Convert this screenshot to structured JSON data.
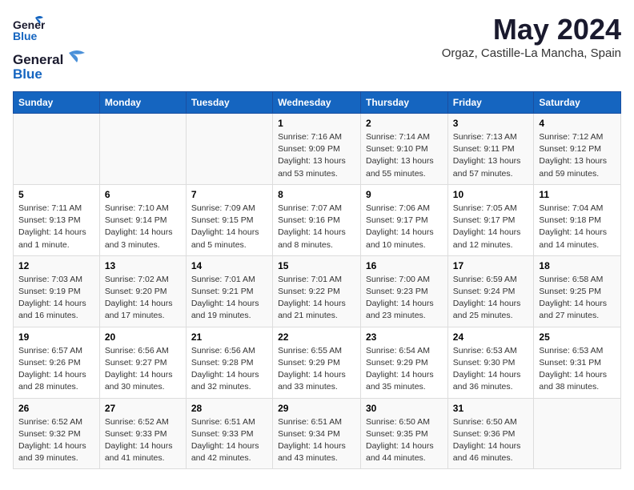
{
  "logo": {
    "line1": "General",
    "line2": "Blue"
  },
  "title": "May 2024",
  "subtitle": "Orgaz, Castille-La Mancha, Spain",
  "weekdays": [
    "Sunday",
    "Monday",
    "Tuesday",
    "Wednesday",
    "Thursday",
    "Friday",
    "Saturday"
  ],
  "weeks": [
    [
      {
        "day": "",
        "info": ""
      },
      {
        "day": "",
        "info": ""
      },
      {
        "day": "",
        "info": ""
      },
      {
        "day": "1",
        "info": "Sunrise: 7:16 AM\nSunset: 9:09 PM\nDaylight: 13 hours and 53 minutes."
      },
      {
        "day": "2",
        "info": "Sunrise: 7:14 AM\nSunset: 9:10 PM\nDaylight: 13 hours and 55 minutes."
      },
      {
        "day": "3",
        "info": "Sunrise: 7:13 AM\nSunset: 9:11 PM\nDaylight: 13 hours and 57 minutes."
      },
      {
        "day": "4",
        "info": "Sunrise: 7:12 AM\nSunset: 9:12 PM\nDaylight: 13 hours and 59 minutes."
      }
    ],
    [
      {
        "day": "5",
        "info": "Sunrise: 7:11 AM\nSunset: 9:13 PM\nDaylight: 14 hours and 1 minute."
      },
      {
        "day": "6",
        "info": "Sunrise: 7:10 AM\nSunset: 9:14 PM\nDaylight: 14 hours and 3 minutes."
      },
      {
        "day": "7",
        "info": "Sunrise: 7:09 AM\nSunset: 9:15 PM\nDaylight: 14 hours and 5 minutes."
      },
      {
        "day": "8",
        "info": "Sunrise: 7:07 AM\nSunset: 9:16 PM\nDaylight: 14 hours and 8 minutes."
      },
      {
        "day": "9",
        "info": "Sunrise: 7:06 AM\nSunset: 9:17 PM\nDaylight: 14 hours and 10 minutes."
      },
      {
        "day": "10",
        "info": "Sunrise: 7:05 AM\nSunset: 9:17 PM\nDaylight: 14 hours and 12 minutes."
      },
      {
        "day": "11",
        "info": "Sunrise: 7:04 AM\nSunset: 9:18 PM\nDaylight: 14 hours and 14 minutes."
      }
    ],
    [
      {
        "day": "12",
        "info": "Sunrise: 7:03 AM\nSunset: 9:19 PM\nDaylight: 14 hours and 16 minutes."
      },
      {
        "day": "13",
        "info": "Sunrise: 7:02 AM\nSunset: 9:20 PM\nDaylight: 14 hours and 17 minutes."
      },
      {
        "day": "14",
        "info": "Sunrise: 7:01 AM\nSunset: 9:21 PM\nDaylight: 14 hours and 19 minutes."
      },
      {
        "day": "15",
        "info": "Sunrise: 7:01 AM\nSunset: 9:22 PM\nDaylight: 14 hours and 21 minutes."
      },
      {
        "day": "16",
        "info": "Sunrise: 7:00 AM\nSunset: 9:23 PM\nDaylight: 14 hours and 23 minutes."
      },
      {
        "day": "17",
        "info": "Sunrise: 6:59 AM\nSunset: 9:24 PM\nDaylight: 14 hours and 25 minutes."
      },
      {
        "day": "18",
        "info": "Sunrise: 6:58 AM\nSunset: 9:25 PM\nDaylight: 14 hours and 27 minutes."
      }
    ],
    [
      {
        "day": "19",
        "info": "Sunrise: 6:57 AM\nSunset: 9:26 PM\nDaylight: 14 hours and 28 minutes."
      },
      {
        "day": "20",
        "info": "Sunrise: 6:56 AM\nSunset: 9:27 PM\nDaylight: 14 hours and 30 minutes."
      },
      {
        "day": "21",
        "info": "Sunrise: 6:56 AM\nSunset: 9:28 PM\nDaylight: 14 hours and 32 minutes."
      },
      {
        "day": "22",
        "info": "Sunrise: 6:55 AM\nSunset: 9:29 PM\nDaylight: 14 hours and 33 minutes."
      },
      {
        "day": "23",
        "info": "Sunrise: 6:54 AM\nSunset: 9:29 PM\nDaylight: 14 hours and 35 minutes."
      },
      {
        "day": "24",
        "info": "Sunrise: 6:53 AM\nSunset: 9:30 PM\nDaylight: 14 hours and 36 minutes."
      },
      {
        "day": "25",
        "info": "Sunrise: 6:53 AM\nSunset: 9:31 PM\nDaylight: 14 hours and 38 minutes."
      }
    ],
    [
      {
        "day": "26",
        "info": "Sunrise: 6:52 AM\nSunset: 9:32 PM\nDaylight: 14 hours and 39 minutes."
      },
      {
        "day": "27",
        "info": "Sunrise: 6:52 AM\nSunset: 9:33 PM\nDaylight: 14 hours and 41 minutes."
      },
      {
        "day": "28",
        "info": "Sunrise: 6:51 AM\nSunset: 9:33 PM\nDaylight: 14 hours and 42 minutes."
      },
      {
        "day": "29",
        "info": "Sunrise: 6:51 AM\nSunset: 9:34 PM\nDaylight: 14 hours and 43 minutes."
      },
      {
        "day": "30",
        "info": "Sunrise: 6:50 AM\nSunset: 9:35 PM\nDaylight: 14 hours and 44 minutes."
      },
      {
        "day": "31",
        "info": "Sunrise: 6:50 AM\nSunset: 9:36 PM\nDaylight: 14 hours and 46 minutes."
      },
      {
        "day": "",
        "info": ""
      }
    ]
  ]
}
